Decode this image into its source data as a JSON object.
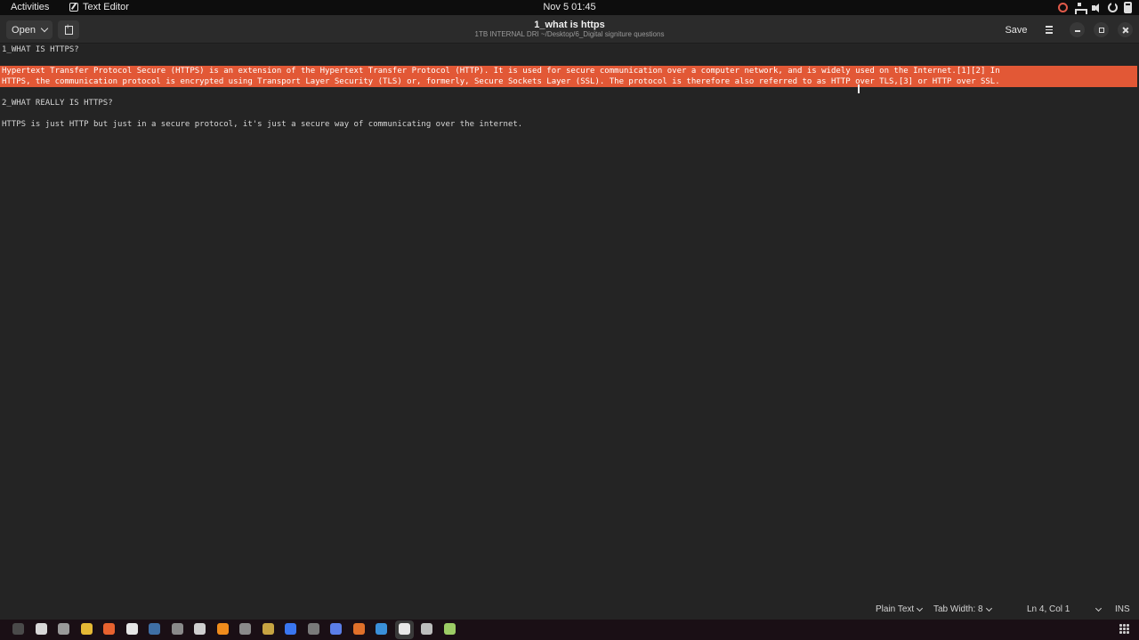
{
  "topbar": {
    "activities": "Activities",
    "app_name": "Text Editor",
    "datetime": "Nov 5  01:45"
  },
  "header": {
    "open_label": "Open",
    "title": "1_what is https",
    "subtitle": "1TB INTERNAL DRI ~/Desktop/6_Digital signiture questions",
    "save_label": "Save"
  },
  "editor": {
    "lines": [
      "1_WHAT IS HTTPS?",
      "Hypertext Transfer Protocol Secure (HTTPS) is an extension of the Hypertext Transfer Protocol (HTTP). It is used for secure communication over a computer network, and is widely used on the Internet.[1][2] In",
      "HTTPS, the communication protocol is encrypted using Transport Layer Security (TLS) or, formerly, Secure Sockets Layer (SSL). The protocol is therefore also referred to as HTTP over TLS,[3] or HTTP over SSL.",
      "2_WHAT REALLY IS HTTPS?",
      "HTTPS is just HTTP but just in a secure protocol, it's just a secure way of communicating over the internet."
    ],
    "selection_color": "#e25836"
  },
  "statusbar": {
    "language": "Plain Text",
    "tab_width": "Tab Width: 8",
    "position": "Ln 4, Col 1",
    "mode": "INS"
  },
  "dock": {
    "icons": [
      {
        "name": "terminal-icon",
        "color": "#4a4a4a"
      },
      {
        "name": "text-editor-alt-icon",
        "color": "#d8d8d8"
      },
      {
        "name": "files-icon",
        "color": "#9a9a9a"
      },
      {
        "name": "chrome-icon",
        "color": "#e5b935"
      },
      {
        "name": "firefox-icon",
        "color": "#e8622f"
      },
      {
        "name": "github-desktop-icon",
        "color": "#e6e6e6"
      },
      {
        "name": "steam-icon",
        "color": "#3f6fa6"
      },
      {
        "name": "monitor-icon",
        "color": "#8a8a8a"
      },
      {
        "name": "obs-icon",
        "color": "#cfcfcf"
      },
      {
        "name": "vlc-icon",
        "color": "#f08c1c"
      },
      {
        "name": "inkscape-icon",
        "color": "#8a8a8a"
      },
      {
        "name": "blender-icon",
        "color": "#c7a442"
      },
      {
        "name": "signal-icon",
        "color": "#3a76f0"
      },
      {
        "name": "settings-icon",
        "color": "#7a7a7a"
      },
      {
        "name": "chat-icon",
        "color": "#5b7ee8"
      },
      {
        "name": "ubuntu-software-icon",
        "color": "#e0702a"
      },
      {
        "name": "browser-icon",
        "color": "#3a8fd9"
      },
      {
        "name": "text-editor-icon",
        "color": "#e8e8e8"
      },
      {
        "name": "document-viewer-icon",
        "color": "#bdbdbd"
      },
      {
        "name": "trash-icon",
        "color": "#9ccc65"
      }
    ]
  }
}
